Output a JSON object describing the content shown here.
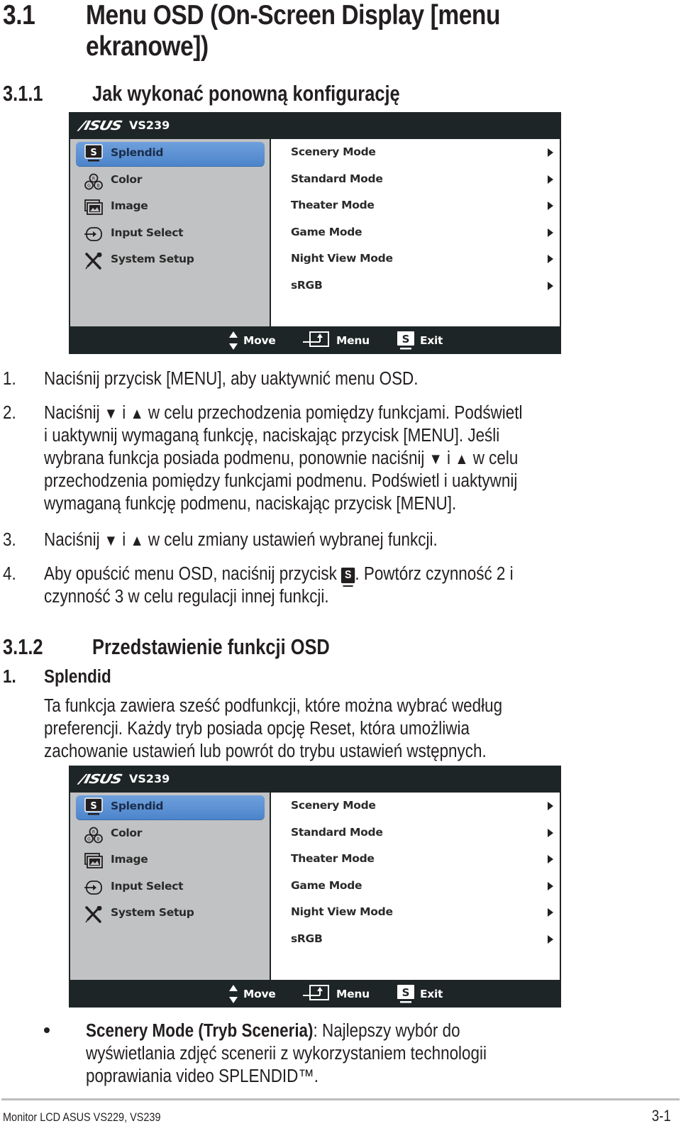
{
  "section": {
    "number": "3.1",
    "title_line1": "Menu OSD (On-Screen Display [menu",
    "title_line2": "ekranowe])"
  },
  "subsection1": {
    "number": "3.1.1",
    "title": "Jak wykonać ponowną konfigurację"
  },
  "osd": {
    "brand": "/ISUS",
    "model": "VS239",
    "menu_items": [
      {
        "label": "Splendid",
        "icon": "splendid-s-icon",
        "selected": true
      },
      {
        "label": "Color",
        "icon": "rgb-color-icon",
        "selected": false
      },
      {
        "label": "Image",
        "icon": "image-icon",
        "selected": false
      },
      {
        "label": "Input Select",
        "icon": "input-select-icon",
        "selected": false
      },
      {
        "label": "System Setup",
        "icon": "wrench-screwdriver-icon",
        "selected": false
      }
    ],
    "submenu_items": [
      {
        "label": "Scenery Mode",
        "icon": "triangle-right-icon"
      },
      {
        "label": "Standard Mode",
        "icon": "triangle-right-icon"
      },
      {
        "label": "Theater Mode",
        "icon": "triangle-right-icon"
      },
      {
        "label": "Game Mode",
        "icon": "triangle-right-icon"
      },
      {
        "label": "Night View Mode",
        "icon": "triangle-right-icon"
      },
      {
        "label": "sRGB",
        "icon": "triangle-right-icon"
      }
    ],
    "footer": [
      {
        "label": "Move",
        "icon": "up-down-arrows-icon"
      },
      {
        "label": "Menu",
        "icon": "enter-icon"
      },
      {
        "label": "Exit",
        "icon": "s-button-icon"
      }
    ],
    "colors": {
      "frame": "#1e2526",
      "left_panel": "#c1c2c3",
      "right_panel": "#ffffff",
      "selection": "#5b8fd3"
    }
  },
  "steps": [
    {
      "num": "1.",
      "lines": [
        "Naciśnij przycisk [MENU], aby uaktywnić menu OSD."
      ]
    },
    {
      "num": "2.",
      "lines": [
        "Naciśnij ▼ i ▲ w celu przechodzenia pomiędzy funkcjami. Podświetl",
        "i uaktywnij wymaganą funkcję, naciskając przycisk [MENU]. Jeśli",
        "wybrana funkcja posiada podmenu, ponownie naciśnij ▼ i ▲ w celu",
        "przechodzenia pomiędzy funkcjami podmenu. Podświetl i uaktywnij",
        "wymaganą funkcję podmenu, naciskając przycisk [MENU]."
      ]
    },
    {
      "num": "3.",
      "lines": [
        "Naciśnij ▼ i ▲ w celu zmiany ustawień wybranej funkcji."
      ]
    },
    {
      "num": "4.",
      "line1_before": "Aby opuścić menu OSD, naciśnij przycisk ",
      "line1_icon": "S",
      "line1_after": ". Powtórz czynność 2 i",
      "line2": "czynność 3 w celu regulacji innej funkcji."
    }
  ],
  "subsection2": {
    "number": "3.1.2",
    "title": "Przedstawienie funkcji OSD"
  },
  "feature1": {
    "num": "1.",
    "title": "Splendid",
    "desc": [
      "Ta funkcja zawiera sześć podfunkcji, które można wybrać według",
      "preferencji. Każdy tryb posiada opcję Reset, która umożliwia",
      "zachowanie ustawień lub powrót do trybu ustawień wstępnych."
    ]
  },
  "bullet1": {
    "bold": "Scenery Mode (Tryb Sceneria)",
    "rest_line1": ": Najlepszy wybór do",
    "line2": "wyświetlania zdjęć scenerii z wykorzystaniem technologii",
    "line3": "poprawiania video SPLENDID™."
  },
  "footer": {
    "left": "Monitor LCD ASUS VS229, VS239",
    "page": "3-1"
  }
}
